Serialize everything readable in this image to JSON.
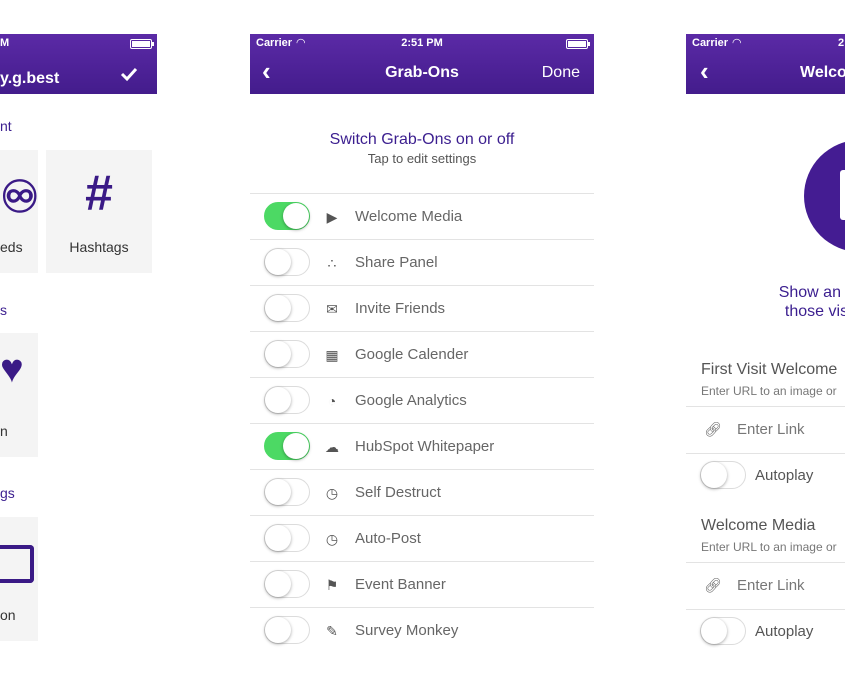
{
  "colors": {
    "nav_purple": "#4a1f95",
    "toggle_on": "#4cd964",
    "accent_text": "#3b1e8f"
  },
  "left_screen": {
    "status_text": "M",
    "title": "y.g.best",
    "check_icon": "checkmark-icon",
    "sections": [
      {
        "label": "nt"
      },
      {
        "label": "s"
      },
      {
        "label": "gs"
      }
    ],
    "tiles": [
      {
        "label": "eds",
        "icon": "feeds-icon"
      },
      {
        "label": "Hashtags",
        "icon": "hashtag-icon"
      },
      {
        "label": "n",
        "icon": "heart-icon"
      },
      {
        "label": "on",
        "icon": "calendar-icon"
      }
    ]
  },
  "middle_screen": {
    "status": {
      "carrier": "Carrier",
      "time": "2:51 PM"
    },
    "nav": {
      "title": "Grab-Ons",
      "back_icon": "chevron-left-icon",
      "done_label": "Done"
    },
    "heading": {
      "title": "Switch Grab-Ons on or off",
      "subtitle": "Tap to edit settings"
    },
    "rows": [
      {
        "label": "Welcome Media",
        "on": true,
        "icon": "play-icon"
      },
      {
        "label": "Share Panel",
        "on": false,
        "icon": "share-icon"
      },
      {
        "label": "Invite Friends",
        "on": false,
        "icon": "envelope-icon"
      },
      {
        "label": "Google Calender",
        "on": false,
        "icon": "calendar-icon"
      },
      {
        "label": "Google Analytics",
        "on": false,
        "icon": "pie-chart-icon"
      },
      {
        "label": "HubSpot Whitepaper",
        "on": true,
        "icon": "cloud-download-icon"
      },
      {
        "label": "Self Destruct",
        "on": false,
        "icon": "clock-icon"
      },
      {
        "label": "Auto-Post",
        "on": false,
        "icon": "clock-icon"
      },
      {
        "label": "Event Banner",
        "on": false,
        "icon": "flag-icon"
      },
      {
        "label": "Survey Monkey",
        "on": false,
        "icon": "edit-icon"
      }
    ]
  },
  "right_screen": {
    "status": {
      "carrier": "Carrier",
      "time": "2"
    },
    "nav": {
      "title": "Welco",
      "back_icon": "chevron-left-icon"
    },
    "show_text": {
      "line1": "Show an im",
      "line2": "those visit"
    },
    "sections": [
      {
        "title": "First Visit Welcome",
        "subtitle": "Enter URL to an image or",
        "link_placeholder": "Enter Link",
        "autoplay_label": "Autoplay",
        "autoplay_on": false
      },
      {
        "title": "Welcome Media",
        "subtitle": "Enter URL to an image or",
        "link_placeholder": "Enter Link",
        "autoplay_label": "Autoplay",
        "autoplay_on": false
      }
    ]
  }
}
